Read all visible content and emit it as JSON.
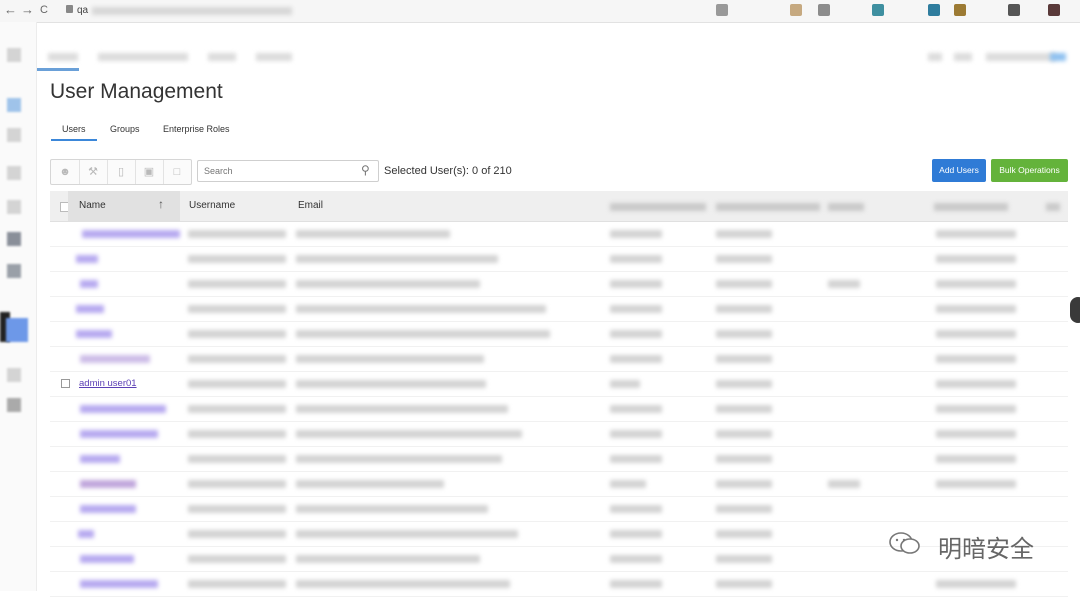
{
  "browser": {
    "url_visible": "qa",
    "back_glyph": "←",
    "forward_glyph": "→",
    "reload_glyph": "C"
  },
  "page": {
    "title": "User Management"
  },
  "tabs": [
    {
      "label": "Users",
      "active": true
    },
    {
      "label": "Groups",
      "active": false
    },
    {
      "label": "Enterprise Roles",
      "active": false
    }
  ],
  "toolbar": {
    "icons": [
      "add-user-icon",
      "wrench-icon",
      "trash-icon",
      "lock-icon",
      "unlock-icon"
    ]
  },
  "search": {
    "placeholder": "Search"
  },
  "selection": {
    "text": "Selected User(s): 0 of 210"
  },
  "actions": {
    "add_users": "Add Users",
    "bulk_operations": "Bulk Operations"
  },
  "table": {
    "columns": [
      "Name",
      "Username",
      "Email"
    ],
    "sort": {
      "column": "Name",
      "direction": "ascending",
      "glyph": "↑"
    },
    "visible_row": {
      "name": "admin user01"
    }
  },
  "watermark": {
    "text": "明暗安全"
  },
  "colors": {
    "primary": "#2f7bd6",
    "success": "#64b33b",
    "link": "#5b3fb5"
  }
}
